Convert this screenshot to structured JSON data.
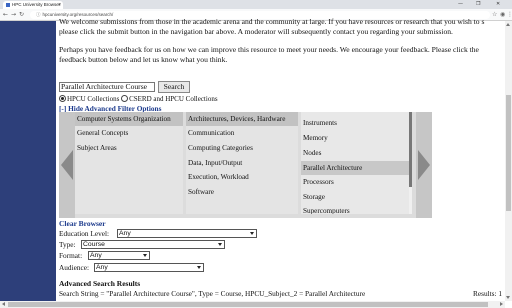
{
  "browser": {
    "tab_title": "HPC University Browser",
    "tab_close": "×",
    "url": "hpcuniversity.org/resources/search/",
    "window_controls": [
      "—",
      "❐",
      "✕"
    ],
    "nav_icons": [
      "back-icon",
      "forward-icon",
      "reload-icon"
    ],
    "nav_glyphs": [
      "←",
      "→",
      "↻"
    ],
    "right_icons": [
      "star-icon",
      "extensions-icon",
      "menu-icon"
    ],
    "right_glyphs": [
      "☆",
      "◉",
      "⋮"
    ]
  },
  "intro": {
    "line1": "We welcome submissions from those in the academic arena and the community at large. If you have resources or research that you wish to s",
    "line2": "please click the submit button in the navigation bar above. A moderator will subsequently contact you regarding your submission.",
    "line3": "Perhaps you have feedback for us on how we can improve this resource to meet your needs. We encourage your feedback. Please click the",
    "line4": "feedback button below and let us know what you think."
  },
  "search": {
    "value": "Parallel Architecture Course",
    "button": "Search"
  },
  "scope": {
    "option1": "HPCU Collections",
    "option2": "CSERD and HPCU Collections",
    "selected": "HPCU Collections"
  },
  "hide_filter": "[-] Hide Advanced Filter Options",
  "filter": {
    "col1": [
      "Computer Systems Organization",
      "General Concepts",
      "Subject Areas"
    ],
    "col2": [
      "Architectures, Devices, Hardware",
      "Communication",
      "Computing Categories",
      "Data, Input/Output",
      "Execution, Workload",
      "Software"
    ],
    "col3": [
      "Instruments",
      "Memory",
      "Nodes",
      "Parallel Architecture",
      "Processors",
      "Storage",
      "Supercomputers"
    ],
    "selected": [
      "Computer Systems Organization",
      "Architectures, Devices, Hardware",
      "Parallel Architecture"
    ]
  },
  "browser_filters": {
    "clear": "Clear Browser",
    "education_label": "Education Level:",
    "education_value": "Any",
    "type_label": "Type:",
    "type_value": "Course",
    "format_label": "Format:",
    "format_value": "Any",
    "audience_label": "Audience:",
    "audience_value": "Any"
  },
  "advanced": {
    "title": "Advanced Search Results",
    "search_string": "Search String = \"Parallel Architecture Course\", Type = Course, HPCU_Subject_2 = Parallel Architecture",
    "results": "Results: 1"
  },
  "colors": {
    "sideband": "#2d3f7a",
    "link": "#1c3a8c",
    "panel": "#dcdcdc"
  }
}
